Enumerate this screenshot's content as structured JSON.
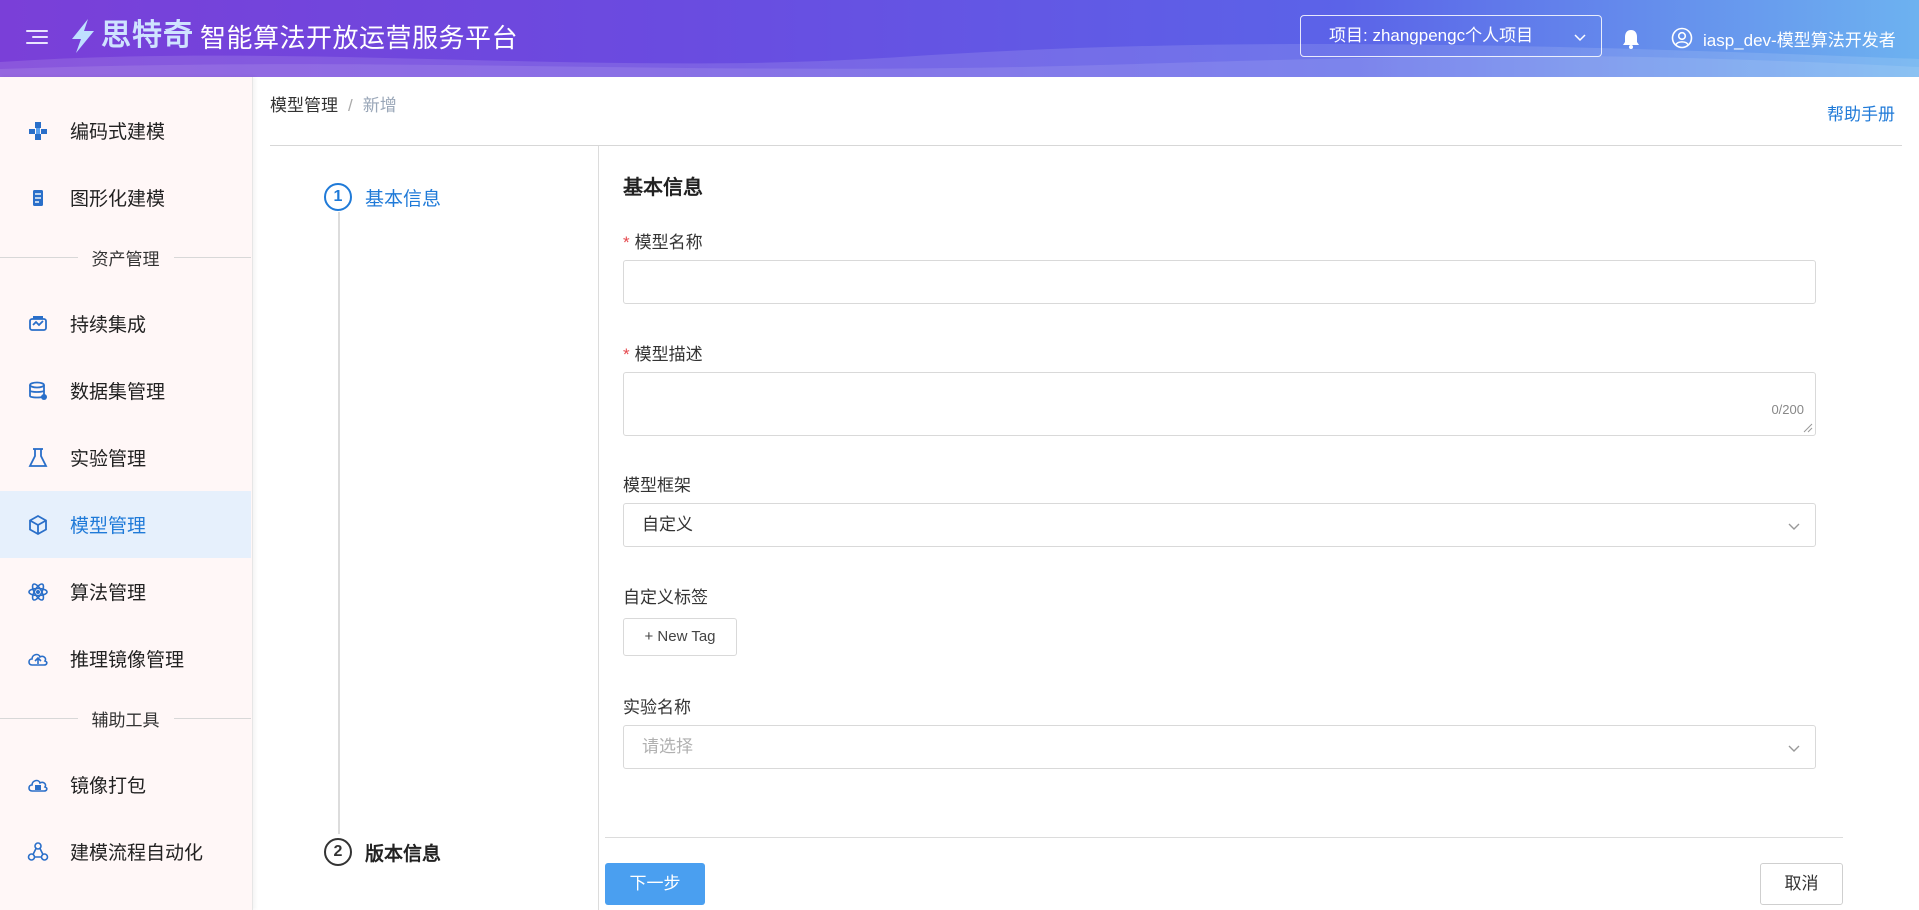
{
  "header": {
    "logo_text": "思特奇",
    "platform_title": "智能算法开放运营服务平台",
    "project_selector": "项目: zhangpengc个人项目",
    "user_name": "iasp_dev-模型算法开发者"
  },
  "sidebar": {
    "items": [
      {
        "label": "编码式建模",
        "icon": "coding-model-icon"
      },
      {
        "label": "图形化建模",
        "icon": "graphic-model-icon"
      },
      {
        "label": "持续集成",
        "icon": "continuous-integration-icon"
      },
      {
        "label": "数据集管理",
        "icon": "dataset-icon"
      },
      {
        "label": "实验管理",
        "icon": "flask-icon"
      },
      {
        "label": "模型管理",
        "icon": "cube-icon",
        "active": true
      },
      {
        "label": "算法管理",
        "icon": "atom-icon"
      },
      {
        "label": "推理镜像管理",
        "icon": "cloud-image-icon"
      },
      {
        "label": "镜像打包",
        "icon": "cloud-package-icon"
      },
      {
        "label": "建模流程自动化",
        "icon": "workflow-icon"
      }
    ],
    "groups": {
      "assets": "资产管理",
      "tools": "辅助工具"
    }
  },
  "breadcrumb": {
    "parent": "模型管理",
    "separator": "/",
    "current": "新增"
  },
  "help_link": "帮助手册",
  "steps": [
    {
      "number": "1",
      "label": "基本信息"
    },
    {
      "number": "2",
      "label": "版本信息"
    }
  ],
  "form": {
    "section_title": "基本信息",
    "required_mark": "*",
    "model_name_label": "模型名称",
    "model_desc_label": "模型描述",
    "desc_counter": "0/200",
    "framework_label": "模型框架",
    "framework_value": "自定义",
    "custom_tags_label": "自定义标签",
    "new_tag_button": "+ New Tag",
    "experiment_label": "实验名称",
    "experiment_placeholder": "请选择"
  },
  "buttons": {
    "next": "下一步",
    "cancel": "取消"
  },
  "colors": {
    "accent": "#1f7ad8",
    "primary_button": "#4a9ff0",
    "active_nav_bg": "#e6f0fc",
    "sidebar_bg": "#fff7f7",
    "required": "#e5484d"
  }
}
